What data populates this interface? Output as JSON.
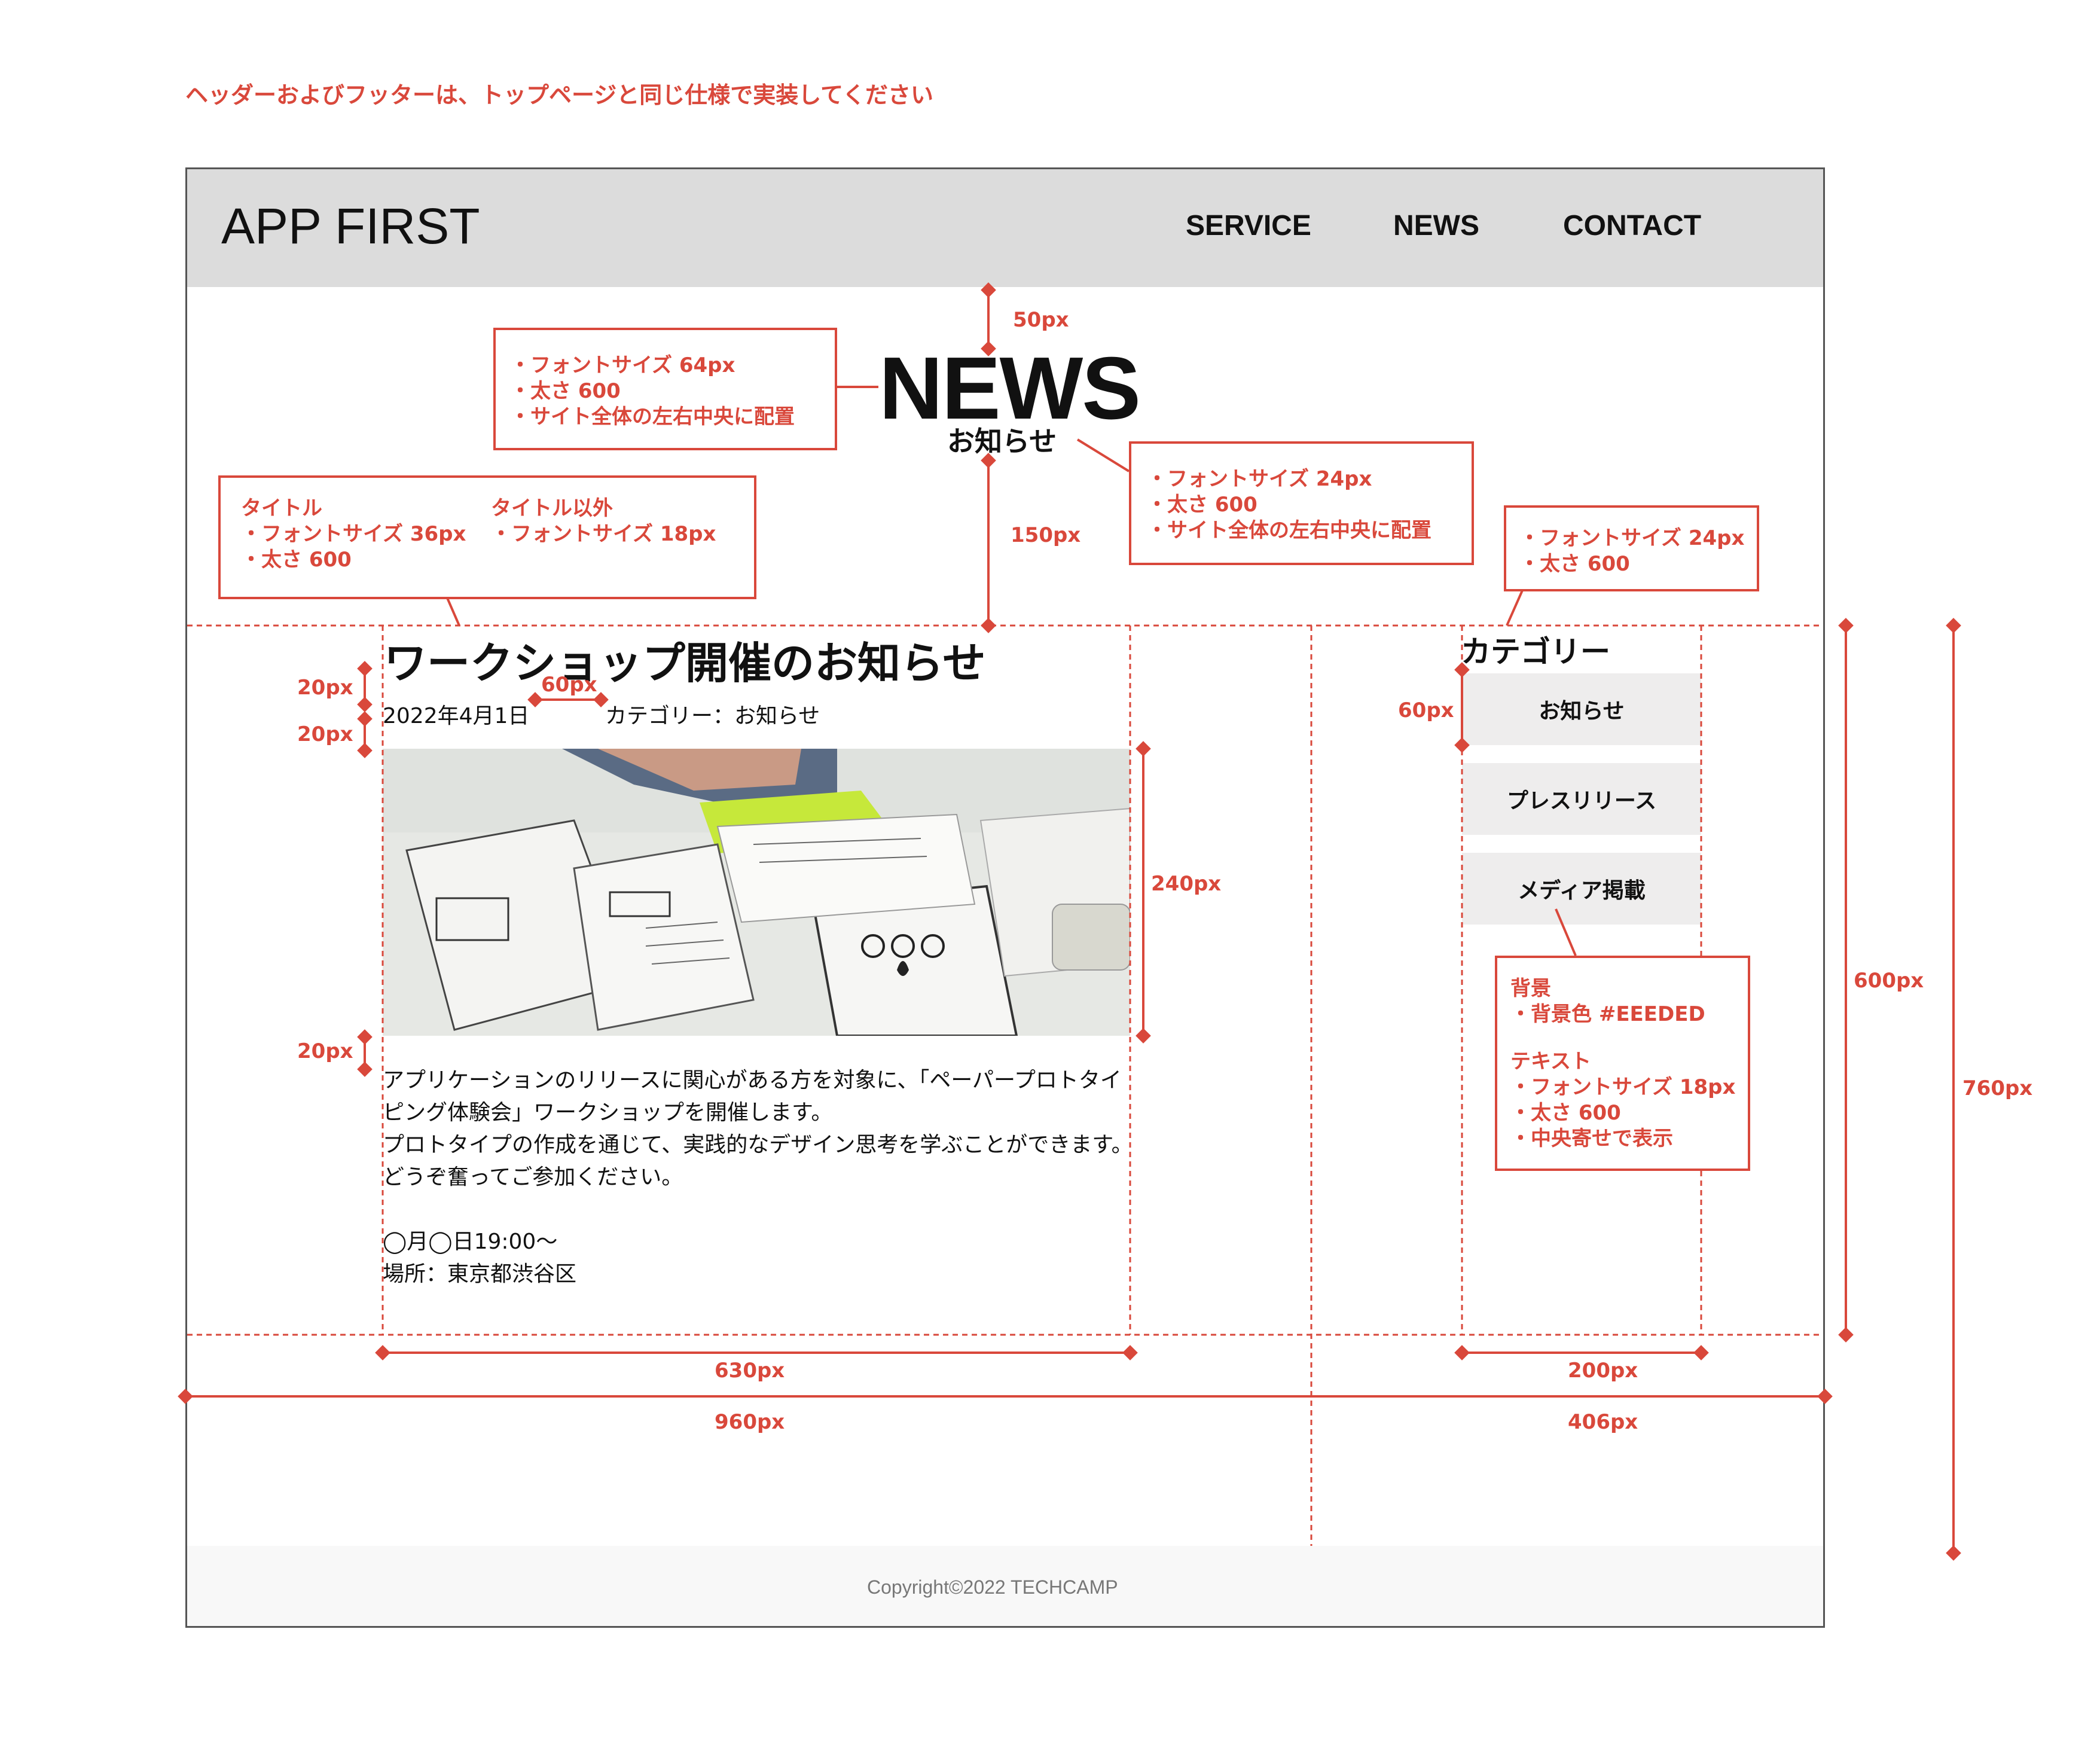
{
  "annotation_top": "ヘッダーおよびフッターは、トップページと同じ仕様で実装してください",
  "header": {
    "logo": "APP FIRST",
    "nav": [
      "SERVICE",
      "NEWS",
      "CONTACT"
    ]
  },
  "page_title": {
    "main": "NEWS",
    "sub": "お知らせ"
  },
  "article": {
    "title": "ワークショップ開催のお知らせ",
    "date": "2022年4月1日",
    "category": "カテゴリー：お知らせ",
    "body": [
      "アプリケーションのリリースに関心がある方を対象に、「ペーパープロトタイ",
      "ピング体験会」ワークショップを開催します。",
      "プロトタイプの作成を通じて、実践的なデザイン思考を学ぶことができます。",
      "どうぞ奮ってご参加ください。",
      "",
      "◯月◯日19:00〜",
      "場所：東京都渋谷区"
    ]
  },
  "sidebar": {
    "heading": "カテゴリー",
    "items": [
      "お知らせ",
      "プレスリリース",
      "メディア掲載"
    ]
  },
  "footer": {
    "copyright": "Copyright©2022 TECHCAMP"
  },
  "notes": {
    "news_title": [
      "・フォントサイズ 64px",
      "・太さ 600",
      "・サイト全体の左右中央に配置"
    ],
    "news_sub": [
      "・フォントサイズ 24px",
      "・太さ 600",
      "・サイト全体の左右中央に配置"
    ],
    "article_title_label": "タイトル",
    "article_title": [
      "・フォントサイズ 36px",
      "・太さ 600"
    ],
    "article_other_label": "タイトル以外",
    "article_other": [
      "・フォントサイズ 18px"
    ],
    "cat_heading": [
      "・フォントサイズ 24px",
      "・太さ 600"
    ],
    "cat_bg_label": "背景",
    "cat_bg": [
      "・背景色 #EEEDED"
    ],
    "cat_text_label": "テキスト",
    "cat_text": [
      "・フォントサイズ 18px",
      "・太さ 600",
      "・中央寄せで表示"
    ]
  },
  "dimensions": {
    "d50": "50px",
    "d150": "150px",
    "d20a": "20px",
    "d20b": "20px",
    "d20c": "20px",
    "d60gap": "60px",
    "d240": "240px",
    "d60side": "60px",
    "d600": "600px",
    "d760": "760px",
    "d630": "630px",
    "d200": "200px",
    "d960": "960px",
    "d406": "406px"
  },
  "colors": {
    "annotation": "#d9483b",
    "header_bg": "#dcdcdc",
    "category_bg": "#eeeded",
    "footer_bg": "#f8f8f8"
  }
}
